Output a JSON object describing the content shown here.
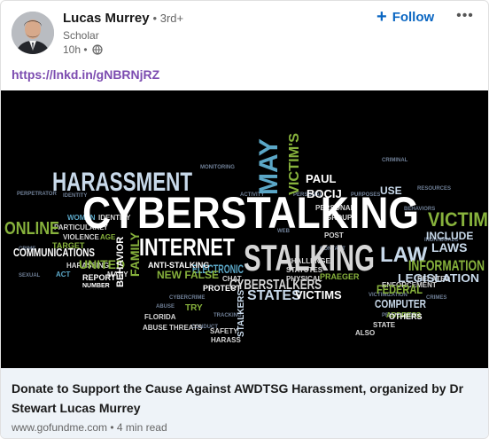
{
  "author": {
    "name": "Lucas Murrey",
    "degree": "• 3rd+",
    "headline": "Scholar",
    "time": "10h •",
    "visibility_icon": "globe-icon"
  },
  "actions": {
    "follow_label": "Follow",
    "follow_icon": "plus-icon",
    "more_icon": "more-horizontal-icon"
  },
  "post": {
    "link_text": "https://lnkd.in/gNBRNjRZ"
  },
  "wordcloud": {
    "words": [
      "HARASSMENT",
      "CYBERSTALKING",
      "MAY",
      "VICTIM'S",
      "PAUL",
      "BOCIJ",
      "USE",
      "ONLINE",
      "VICTIM",
      "INTERNET",
      "STALKING",
      "LAW",
      "INFORMATION",
      "COMMUNICATIONS",
      "UNITED",
      "FAMILY",
      "BEHAVIOR",
      "ELECTRONIC",
      "CYBERSTALKERS",
      "STATES",
      "VICTIMS",
      "COMPUTER",
      "LEGISLATION",
      "LAWS",
      "INCLUDE",
      "CHALLENGE",
      "STATUTES",
      "FEDERAL",
      "OTHERS",
      "ACT",
      "VIOLENCE",
      "AGE",
      "TARGET",
      "STALKERS",
      "NEW",
      "FALSE",
      "ANTI-STALKING",
      "REPORT",
      "FLORIDA",
      "PROTECT",
      "PRAEGER",
      "ADDRESS",
      "POST",
      "THREATS",
      "ABUSE",
      "CRIME",
      "PERSONAL",
      "SAFETY",
      "CHAT",
      "TRY",
      "ENFORCEMENT",
      "STATE",
      "MANY",
      "WOMEN",
      "IDENTITY",
      "GROUP",
      "NUMBER",
      "HARASSING",
      "MAY",
      "ALSO",
      "DATA"
    ]
  },
  "preview": {
    "title": "Donate to Support the Cause Against AWDTSG Harassment, organized by Dr Stewart Lucas Murrey",
    "source": "www.gofundme.com • 4 min read"
  }
}
